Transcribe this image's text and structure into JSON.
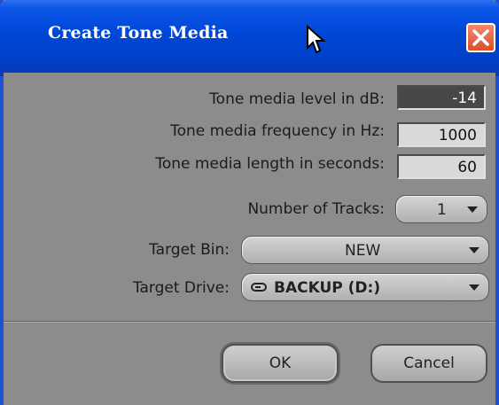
{
  "window": {
    "title": "Create Tone Media"
  },
  "fields": {
    "level_label": "Tone media level in dB:",
    "level_value": "-14",
    "frequency_label": "Tone media frequency in Hz:",
    "frequency_value": "1000",
    "length_label": "Tone media length in seconds:",
    "length_value": "60"
  },
  "tracks": {
    "label": "Number of Tracks:",
    "value": "1"
  },
  "target_bin": {
    "label": "Target Bin:",
    "value": "NEW"
  },
  "target_drive": {
    "label": "Target Drive:",
    "value": "BACKUP (D:)",
    "icon": "drive-icon"
  },
  "buttons": {
    "ok": "OK",
    "cancel": "Cancel"
  },
  "colors": {
    "titlebar": "#0047d6",
    "close": "#dc4f2a",
    "dialog_bg": "#8c8c8c"
  }
}
